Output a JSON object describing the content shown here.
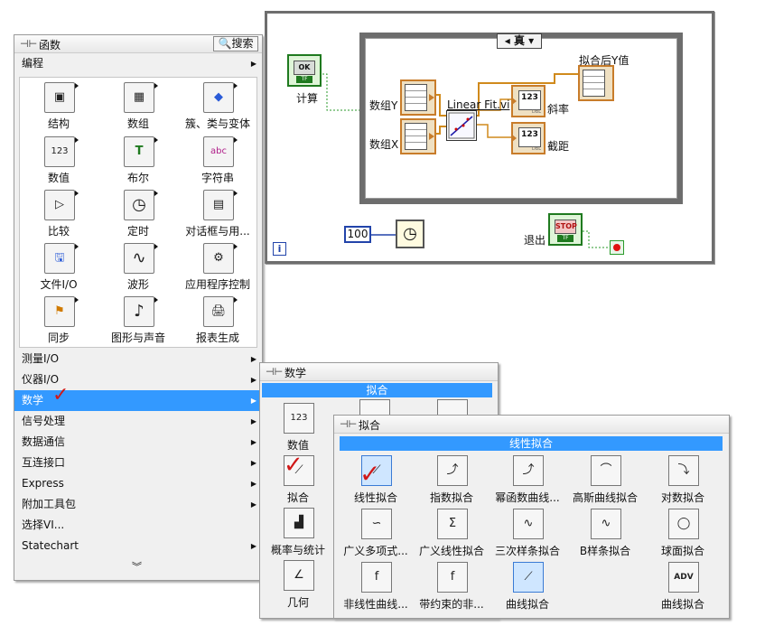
{
  "diagram": {
    "case_selector": "◂ 真 ▾",
    "info_icon": "i",
    "labels": {
      "compute": "计算",
      "array_y": "数组Y",
      "array_x": "数组X",
      "vi_name": "Linear Fit.vi",
      "fitted_y": "拟合后Y值",
      "slope": "斜率",
      "intercept": "截距",
      "exit": "退出",
      "wait_value": "100"
    },
    "buttons": {
      "ok": "OK",
      "stop": "STOP",
      "tf": "TF"
    },
    "numeric_label": "123",
    "dbl": "DBL"
  },
  "palette": {
    "title": "函数",
    "search": "搜索",
    "section": "编程",
    "items": [
      {
        "label": "结构",
        "icon": "structure-icon",
        "glyph": "▣"
      },
      {
        "label": "数组",
        "icon": "array-icon",
        "glyph": "▦"
      },
      {
        "label": "簇、类与变体",
        "icon": "cluster-icon",
        "glyph": "◆"
      },
      {
        "label": "数值",
        "icon": "numeric-icon",
        "glyph": "123"
      },
      {
        "label": "布尔",
        "icon": "boolean-icon",
        "glyph": "T"
      },
      {
        "label": "字符串",
        "icon": "string-icon",
        "glyph": "abc"
      },
      {
        "label": "比较",
        "icon": "comparison-icon",
        "glyph": "▷"
      },
      {
        "label": "定时",
        "icon": "timing-icon",
        "glyph": "◷"
      },
      {
        "label": "对话框与用...",
        "icon": "dialog-icon",
        "glyph": "▤"
      },
      {
        "label": "文件I/O",
        "icon": "file-io-icon",
        "glyph": "🖫"
      },
      {
        "label": "波形",
        "icon": "waveform-icon",
        "glyph": "∿"
      },
      {
        "label": "应用程序控制",
        "icon": "app-control-icon",
        "glyph": "⚙"
      },
      {
        "label": "同步",
        "icon": "sync-icon",
        "glyph": "⚑"
      },
      {
        "label": "图形与声音",
        "icon": "graphics-sound-icon",
        "glyph": "♪"
      },
      {
        "label": "报表生成",
        "icon": "report-icon",
        "glyph": "🖨"
      }
    ],
    "categories": [
      {
        "label": "测量I/O"
      },
      {
        "label": "仪器I/O"
      },
      {
        "label": "数学"
      },
      {
        "label": "信号处理"
      },
      {
        "label": "数据通信"
      },
      {
        "label": "互连接口"
      },
      {
        "label": "Express"
      },
      {
        "label": "附加工具包"
      },
      {
        "label": "选择VI..."
      },
      {
        "label": "Statechart"
      }
    ],
    "more": "︾"
  },
  "math_menu": {
    "title": "数学",
    "header": "拟合",
    "items": [
      {
        "label": "数值",
        "glyph": "123"
      },
      {
        "label": "拟合",
        "glyph": "⟋"
      },
      {
        "label": "概率与统计",
        "glyph": "▟"
      },
      {
        "label": "几何",
        "glyph": "∠"
      }
    ]
  },
  "fit_menu": {
    "title": "拟合",
    "header": "线性拟合",
    "items": [
      {
        "label": "线性拟合",
        "glyph": "⟋"
      },
      {
        "label": "指数拟合",
        "glyph": "⤴"
      },
      {
        "label": "幂函数曲线...",
        "glyph": "⤴"
      },
      {
        "label": "高斯曲线拟合",
        "glyph": "⌒"
      },
      {
        "label": "对数拟合",
        "glyph": "⤵"
      },
      {
        "label": "广义多项式...",
        "glyph": "∽"
      },
      {
        "label": "广义线性拟合",
        "glyph": "Σ"
      },
      {
        "label": "三次样条拟合",
        "glyph": "∿"
      },
      {
        "label": "B样条拟合",
        "glyph": "∿"
      },
      {
        "label": "球面拟合",
        "glyph": "◯"
      },
      {
        "label": "非线性曲线...",
        "glyph": "f"
      },
      {
        "label": "带约束的非...",
        "glyph": "f"
      },
      {
        "label": "曲线拟合",
        "glyph": "⟋"
      },
      {
        "label": "曲线拟合",
        "glyph": "ADV"
      }
    ]
  }
}
